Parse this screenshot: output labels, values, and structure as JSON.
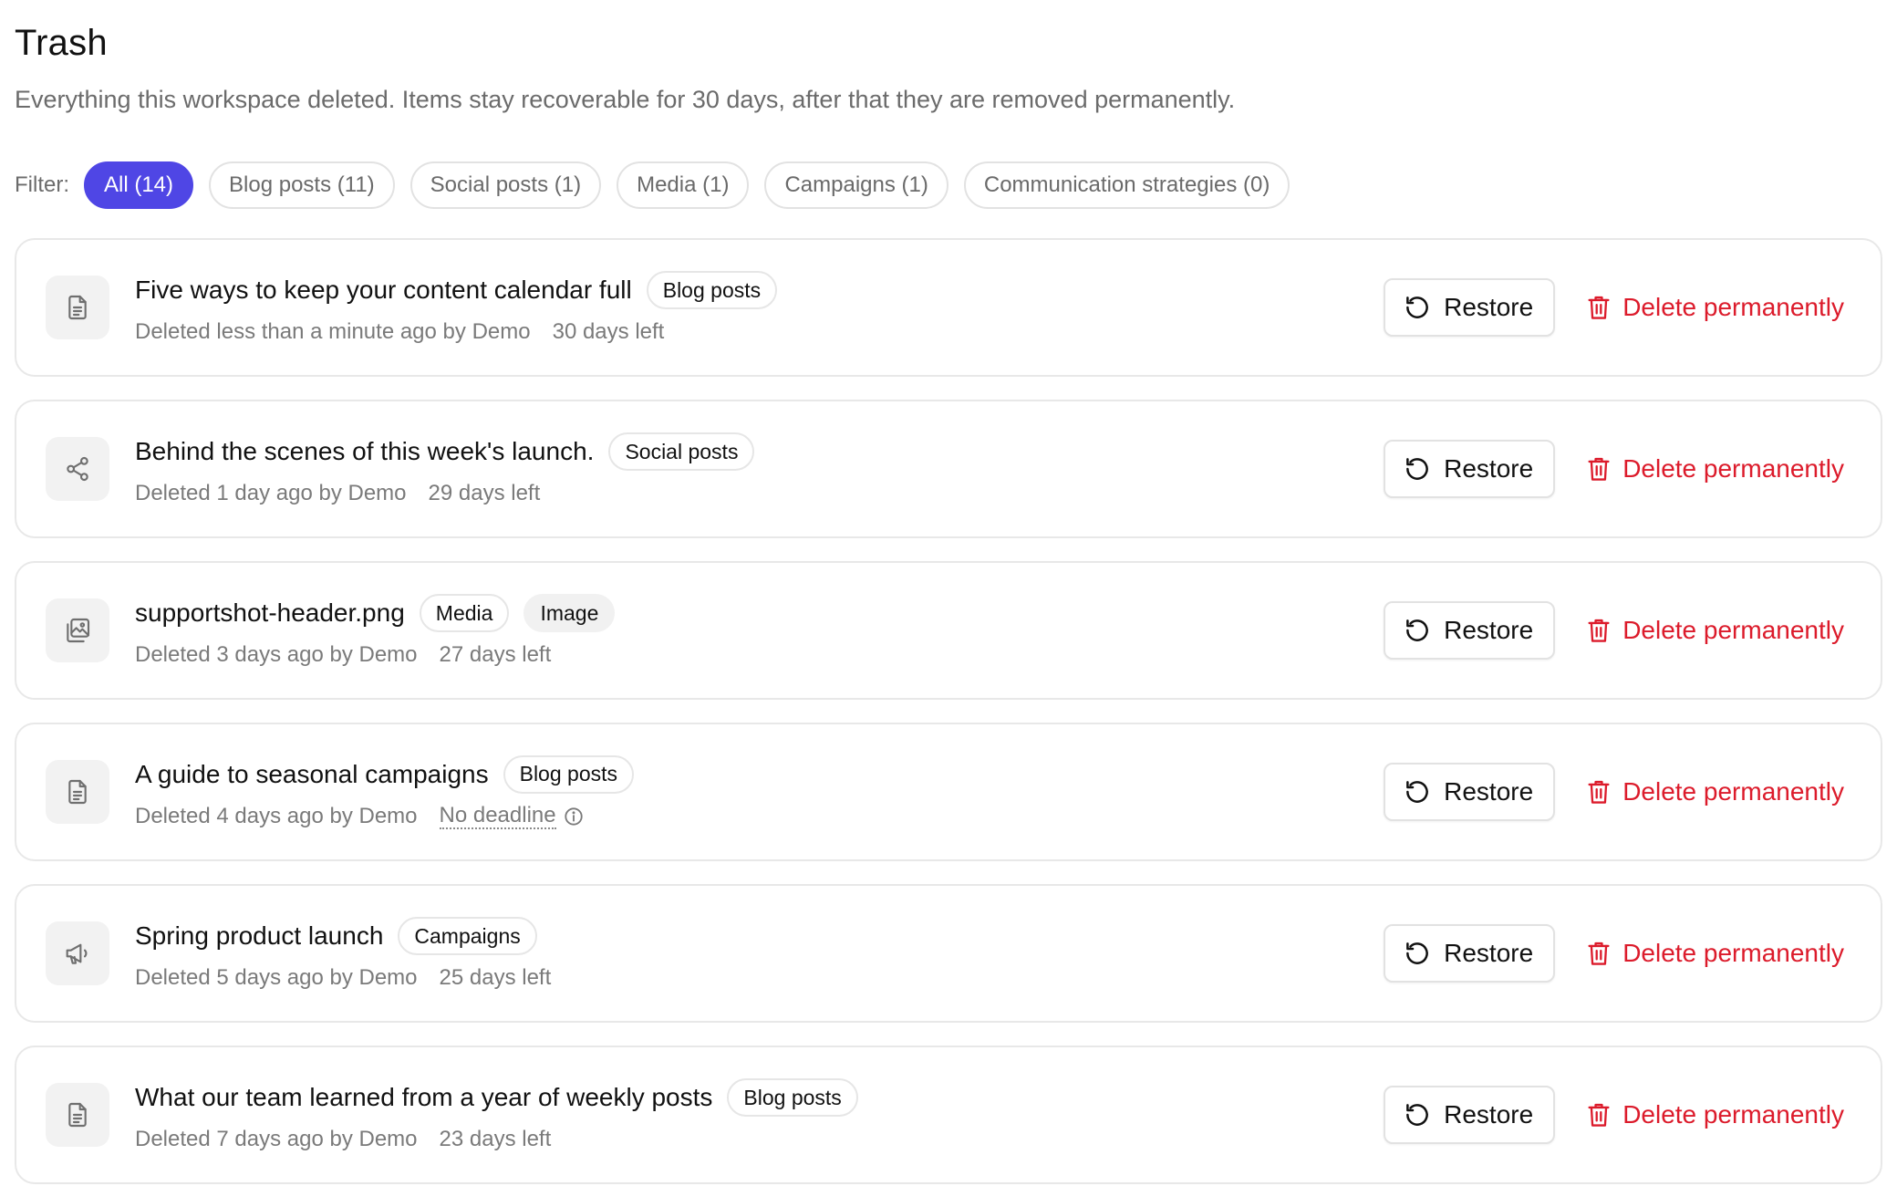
{
  "header": {
    "title": "Trash",
    "subtitle": "Everything this workspace deleted. Items stay recoverable for 30 days, after that they are removed permanently."
  },
  "filter": {
    "label": "Filter:",
    "options": [
      {
        "label": "All (14)",
        "active": true
      },
      {
        "label": "Blog posts (11)",
        "active": false
      },
      {
        "label": "Social posts (1)",
        "active": false
      },
      {
        "label": "Media (1)",
        "active": false
      },
      {
        "label": "Campaigns (1)",
        "active": false
      },
      {
        "label": "Communication strategies (0)",
        "active": false
      }
    ]
  },
  "actions": {
    "restore_label": "Restore",
    "delete_label": "Delete permanently"
  },
  "items": [
    {
      "icon": "document-icon",
      "title": "Five ways to keep your content calendar full",
      "badges": [
        "Blog posts"
      ],
      "deleted": "Deleted less than a minute ago by Demo",
      "remaining": "30 days left"
    },
    {
      "icon": "share-icon",
      "title": "Behind the scenes of this week's launch.",
      "badges": [
        "Social posts"
      ],
      "deleted": "Deleted 1 day ago by Demo",
      "remaining": "29 days left"
    },
    {
      "icon": "image-gallery-icon",
      "title": "supportshot-header.png",
      "badges": [
        "Media",
        "Image"
      ],
      "deleted": "Deleted 3 days ago by Demo",
      "remaining": "27 days left"
    },
    {
      "icon": "document-icon",
      "title": "A guide to seasonal campaigns",
      "badges": [
        "Blog posts"
      ],
      "deleted": "Deleted 4 days ago by Demo",
      "remaining": "No deadline"
    },
    {
      "icon": "megaphone-icon",
      "title": "Spring product launch",
      "badges": [
        "Campaigns"
      ],
      "deleted": "Deleted 5 days ago by Demo",
      "remaining": "25 days left"
    },
    {
      "icon": "document-icon",
      "title": "What our team learned from a year of weekly posts",
      "badges": [
        "Blog posts"
      ],
      "deleted": "Deleted 7 days ago by Demo",
      "remaining": "23 days left"
    }
  ],
  "colors": {
    "accent": "#4f46e5",
    "danger": "#dc1b2b",
    "muted_text": "#6b6b6b",
    "border": "#e8e8e8"
  }
}
